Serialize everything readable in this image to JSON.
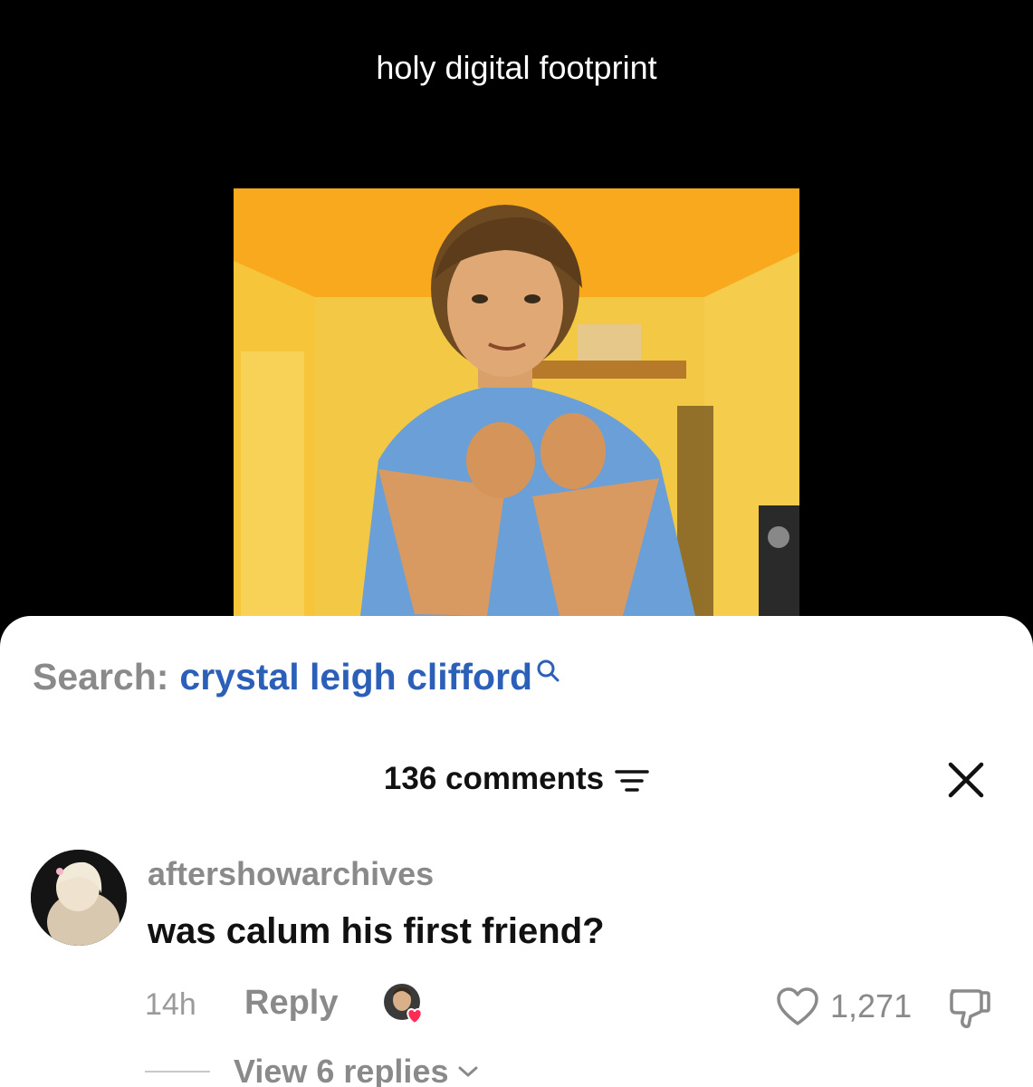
{
  "video": {
    "caption": "holy digital footprint"
  },
  "search": {
    "prefix": "Search:",
    "term": "crystal leigh clifford"
  },
  "comments": {
    "header": "136 comments"
  },
  "comment": {
    "username": "aftershowarchives",
    "text": "was calum his first friend?",
    "time": "14h",
    "reply_label": "Reply",
    "likes": "1,271",
    "view_replies": "View 6 replies"
  },
  "colors": {
    "link_blue": "#2b5fb8",
    "muted_gray": "#8a8a8a",
    "heart_red": "#fe2c55"
  }
}
